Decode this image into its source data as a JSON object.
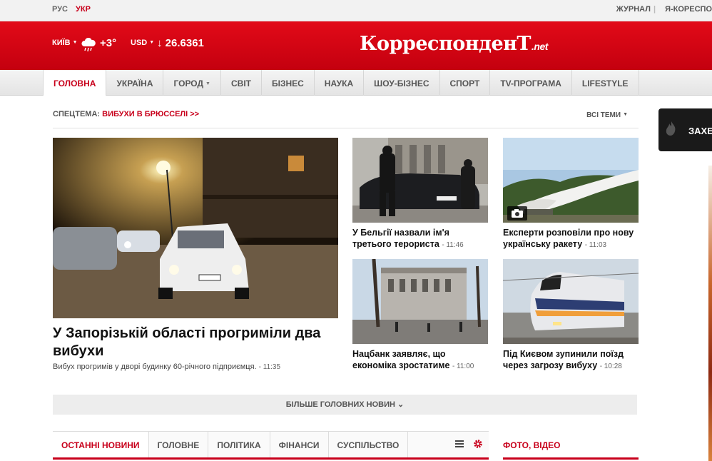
{
  "top": {
    "languages": [
      {
        "label": "РУС",
        "active": false
      },
      {
        "label": "УКР",
        "active": true
      }
    ],
    "links": [
      "ЖУРНАЛ",
      "Я-КОРЕСПО"
    ]
  },
  "header": {
    "city": "КИЇВ",
    "temperature": "+3°",
    "currency": "USD",
    "rate": "↓ 26.6361",
    "logo_main": "КорреспонденТ",
    "logo_suffix": ".net",
    "brand_color": "#d9071a"
  },
  "nav": {
    "items": [
      {
        "label": "ГОЛОВНА",
        "active": true
      },
      {
        "label": "УКРАЇНА"
      },
      {
        "label": "ГОРОД"
      },
      {
        "label": "СВІТ"
      },
      {
        "label": "БІЗНЕС"
      },
      {
        "label": "НАУКА"
      },
      {
        "label": "ШОУ-БІЗНЕС"
      },
      {
        "label": "СПОРТ"
      },
      {
        "label": "TV-ПРОГРАМА"
      },
      {
        "label": "LIFESTYLE"
      }
    ]
  },
  "special": {
    "label": "СПЕЦТЕМА:",
    "link": "ВИБУХИ В БРЮССЕЛІ >>",
    "all_topics": "ВСІ ТЕМИ"
  },
  "promo": {
    "text": "ЗАХЕ"
  },
  "main_story": {
    "title": "У Запорізькій області прогриміли два вибухи",
    "lead": "Вибух прогримів у дворі будинку 60-річного підприємця.",
    "time": "- 11:35"
  },
  "stories": [
    {
      "title": "У Бельгії назвали ім'я третього терориста",
      "time": "- 11:46"
    },
    {
      "title": "Експерти розповіли про нову українську ракету",
      "time": "- 11:03"
    },
    {
      "title": "Нацбанк заявляє, що економіка зростатиме",
      "time": "- 11:00"
    },
    {
      "title": "Під Києвом зупинили поїзд через загрозу вибуху",
      "time": "- 10:28"
    }
  ],
  "more_button": "БІЛЬШЕ ГОЛОВНИХ НОВИН",
  "bottom_tabs": [
    {
      "label": "ОСТАННІ НОВИНИ",
      "active": true
    },
    {
      "label": "ГОЛОВНЕ"
    },
    {
      "label": "ПОЛІТИКА"
    },
    {
      "label": "ФІНАНСИ"
    },
    {
      "label": "СУСПІЛЬСТВО"
    }
  ],
  "photo_video": "ФОТО, ВІДЕО"
}
